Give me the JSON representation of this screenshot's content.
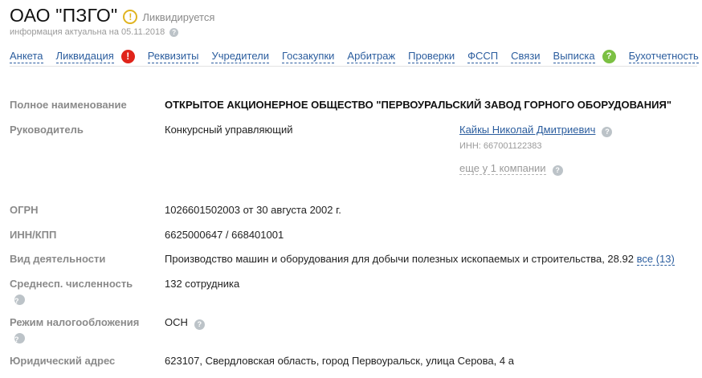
{
  "header": {
    "title": "ОАО \"ПЗГО\"",
    "status": "Ликвидируется",
    "info_date": "информация актуальна на 05.11.2018"
  },
  "tabs": [
    {
      "label": "Анкета"
    },
    {
      "label": "Ликвидация",
      "badge": "!"
    },
    {
      "label": "Реквизиты"
    },
    {
      "label": "Учредители"
    },
    {
      "label": "Госзакупки"
    },
    {
      "label": "Арбитраж"
    },
    {
      "label": "Проверки"
    },
    {
      "label": "ФССП"
    },
    {
      "label": "Связи"
    },
    {
      "label": "Выписка",
      "badge": "?"
    },
    {
      "label": "Бухотчетность"
    }
  ],
  "fields": {
    "full_name": {
      "label": "Полное наименование",
      "value": "ОТКРЫТОЕ АКЦИОНЕРНОЕ ОБЩЕСТВО \"ПЕРВОУРАЛЬСКИЙ ЗАВОД ГОРНОГО ОБОРУДОВАНИЯ\""
    },
    "head": {
      "label": "Руководитель",
      "position": "Конкурсный управляющий",
      "person": "Кайкы Николай Дмитриевич",
      "inn": "ИНН: 667001122383",
      "more": "еще у 1 компании"
    },
    "ogrn": {
      "label": "ОГРН",
      "value": "1026601502003 от 30 августа 2002 г."
    },
    "inn_kpp": {
      "label": "ИНН/КПП",
      "value": "6625000647 / 668401001"
    },
    "activity": {
      "label": "Вид деятельности",
      "value": "Производство машин и оборудования для добычи полезных ископаемых и строительства, 28.92",
      "link": "все (13)"
    },
    "employees": {
      "label": "Среднесп. численность",
      "value": "132 сотрудника"
    },
    "tax": {
      "label": "Режим налогообложения",
      "value": "ОСН"
    },
    "address": {
      "label": "Юридический адрес",
      "value": "623107, Свердловская область, город Первоуральск, улица Серова, 4 а"
    }
  },
  "colors": {
    "link": "#2b5d9e",
    "label": "#8a8a8a",
    "warning": "#e0b420",
    "danger": "#e0241a",
    "success": "#7bc043"
  }
}
